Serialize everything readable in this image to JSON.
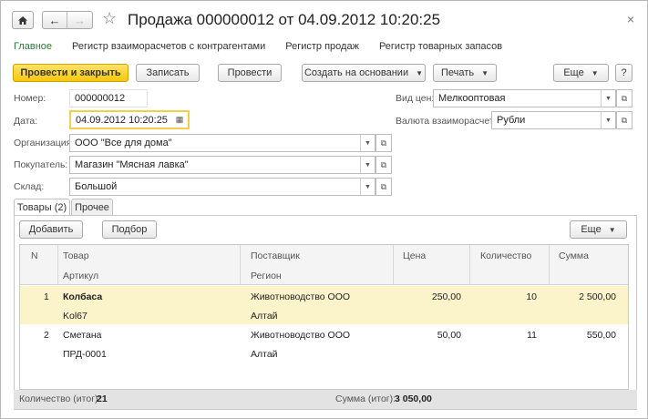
{
  "window": {
    "title": "Продажа 000000012 от 04.09.2012 10:20:25",
    "close": "×"
  },
  "nav": {
    "back": "←",
    "forward": "→",
    "star": "☆"
  },
  "links": [
    "Главное",
    "Регистр взаиморасчетов с контрагентами",
    "Регистр продаж",
    "Регистр товарных запасов"
  ],
  "toolbar": {
    "post_close": "Провести и закрыть",
    "save": "Записать",
    "post": "Провести",
    "create_based": "Создать на основании",
    "print": "Печать",
    "more": "Еще",
    "help": "?"
  },
  "form": {
    "number_label": "Номер:",
    "number_value": "000000012",
    "date_label": "Дата:",
    "date_value": "04.09.2012 10:20:25",
    "org_label": "Организация:",
    "org_value": "ООО \"Все для дома\"",
    "buyer_label": "Покупатель:",
    "buyer_value": "Магазин \"Мясная лавка\"",
    "warehouse_label": "Склад:",
    "warehouse_value": "Большой",
    "price_type_label": "Вид цен:",
    "price_type_value": "Мелкооптовая",
    "currency_label": "Валюта взаиморасчетов:",
    "currency_value": "Рубли"
  },
  "tabs": {
    "goods": "Товары (2)",
    "other": "Прочее"
  },
  "table_toolbar": {
    "add": "Добавить",
    "pick": "Подбор",
    "more": "Еще"
  },
  "table": {
    "headers": {
      "n": "N",
      "product": "Товар",
      "article": "Артикул",
      "supplier": "Поставщик",
      "region": "Регион",
      "price": "Цена",
      "qty": "Количество",
      "sum": "Сумма"
    },
    "rows": [
      {
        "n": "1",
        "product": "Колбаса",
        "article": "Kol67",
        "supplier": "Животноводство ООО",
        "region": "Алтай",
        "price": "250,00",
        "qty": "10",
        "sum": "2 500,00"
      },
      {
        "n": "2",
        "product": "Сметана",
        "article": "ПРД-0001",
        "supplier": "Животноводство ООО",
        "region": "Алтай",
        "price": "50,00",
        "qty": "11",
        "sum": "550,00"
      }
    ]
  },
  "totals": {
    "qty_label": "Количество (итог):",
    "qty_value": "21",
    "sum_label": "Сумма (итог):",
    "sum_value": "3 050,00"
  },
  "colors": {
    "primary_button": "#f7c80b",
    "selected_row": "#fbf3c9",
    "active_link": "#2a7b32"
  }
}
